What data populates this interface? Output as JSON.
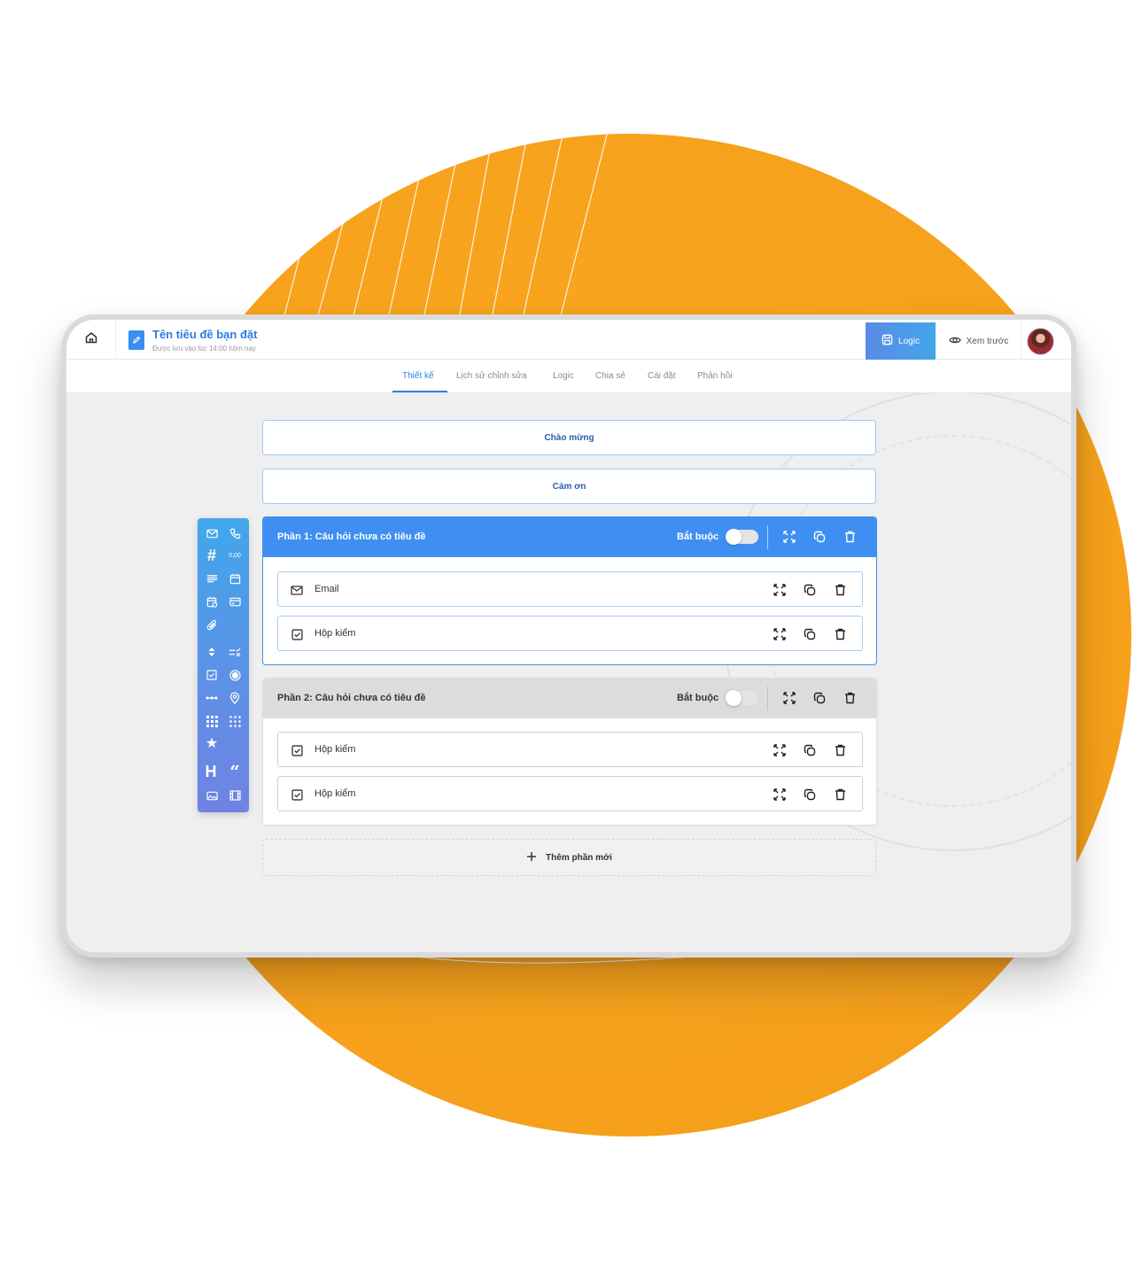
{
  "header": {
    "doc_title": "Tên tiêu đề bạn đặt",
    "doc_subtitle": "Được lưu vào lúc 14:00 hôm nay",
    "logic_button": "Logic",
    "preview_button": "Xem trước"
  },
  "tabs": [
    {
      "label": "Thiết kế",
      "active": true
    },
    {
      "label": "Lịch sử chỉnh sửa",
      "active": false
    },
    {
      "label": "Logic",
      "active": false
    },
    {
      "label": "Chia sẻ",
      "active": false
    },
    {
      "label": "Cài đặt",
      "active": false
    },
    {
      "label": "Phản hồi",
      "active": false
    }
  ],
  "palette": {
    "decimal_label": "0,00",
    "heading_label": "H"
  },
  "screens": {
    "welcome": "Chào mừng",
    "thanks": "Cảm ơn"
  },
  "sections": [
    {
      "title": "Phần 1:  Câu hỏi chưa có tiêu đề",
      "required_label": "Bắt buộc",
      "required": false,
      "fields": [
        {
          "label": "Email",
          "icon": "mail-icon"
        },
        {
          "label": "Hộp kiểm",
          "icon": "checkbox-icon"
        }
      ]
    },
    {
      "title": "Phần 2:  Câu hỏi chưa có tiêu đề",
      "required_label": "Bắt buộc",
      "required": false,
      "fields": [
        {
          "label": "Hộp kiểm",
          "icon": "checkbox-icon"
        },
        {
          "label": "Hộp kiểm",
          "icon": "checkbox-icon"
        }
      ]
    }
  ],
  "add_section_label": "Thêm phần mới",
  "colors": {
    "accent": "#3f8ff2",
    "orange": "#f7a21c",
    "tab_active": "#2b84e6"
  }
}
